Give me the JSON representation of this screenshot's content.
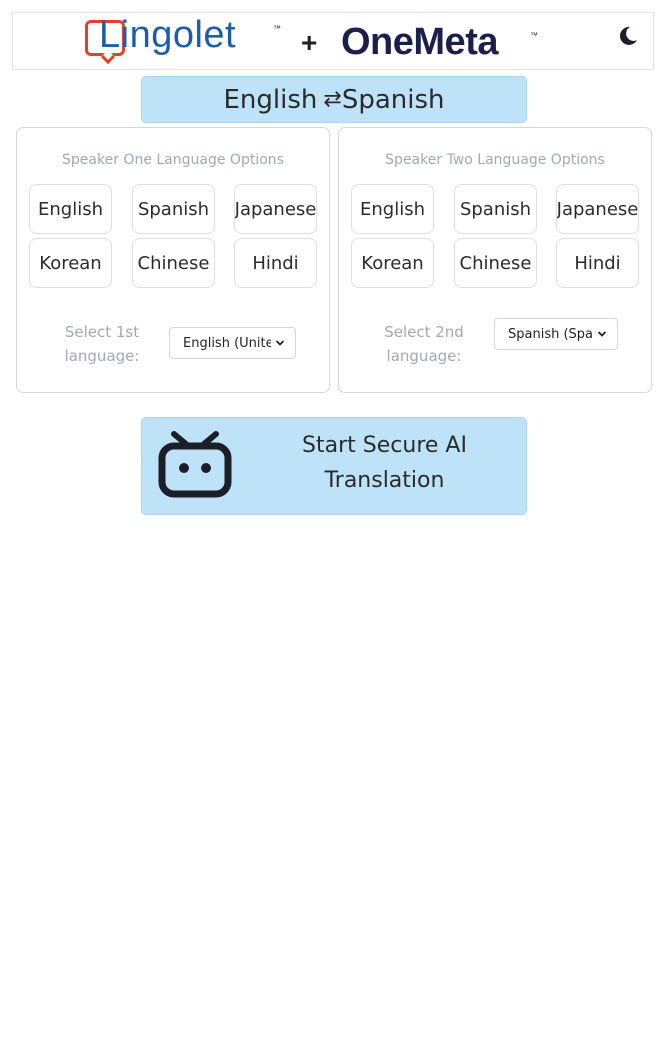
{
  "header": {
    "logo_left_text": "Lingolet",
    "logo_left_tm": "™",
    "plus": "+",
    "logo_right_text": "OneMeta",
    "logo_right_tm": "™",
    "theme_toggle_icon": "moon-icon"
  },
  "language_pair": {
    "from": "English",
    "swap_icon": "⇄",
    "to": "Spanish"
  },
  "speaker_one": {
    "title": "Speaker One Language Options",
    "options": [
      "English",
      "Spanish",
      "Japanese",
      "Korean",
      "Chinese",
      "Hindi"
    ],
    "select_label": "Select 1st language:",
    "select_value": "English (United States)"
  },
  "speaker_two": {
    "title": "Speaker Two Language Options",
    "options": [
      "English",
      "Spanish",
      "Japanese",
      "Korean",
      "Chinese",
      "Hindi"
    ],
    "select_label": "Select 2nd language:",
    "select_value": "Spanish (Spain)"
  },
  "start": {
    "label": "Start Secure AI Translation",
    "icon": "robot-icon"
  },
  "colors": {
    "accent_bg": "#bee3f8",
    "lingolet_red": "#e2412f",
    "lingolet_blue": "#1d5ea8",
    "onemeta_navy": "#1b1f4a",
    "muted_text": "#a0a9b8"
  }
}
